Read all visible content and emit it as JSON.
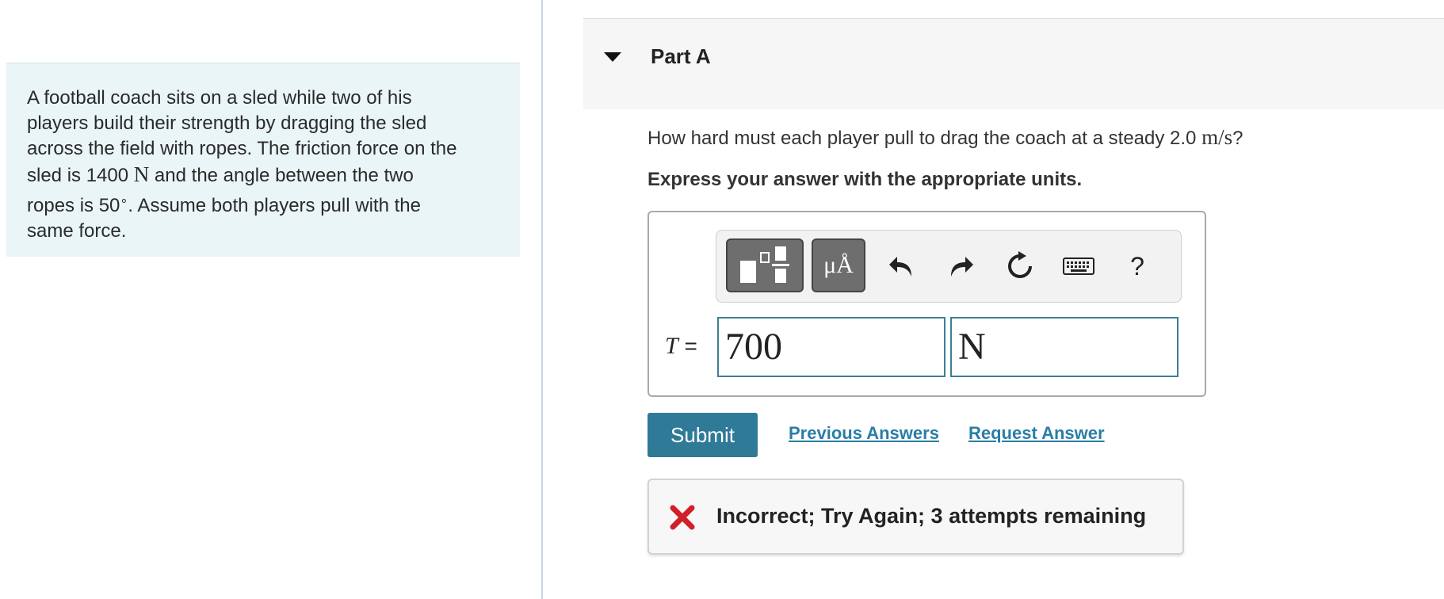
{
  "problem": {
    "line1": "A football coach sits on a sled while two of his",
    "line2": "players build their strength by dragging the sled",
    "line3": "across the field with ropes. The friction force on the",
    "line4_pre": "sled is 1400 ",
    "line4_unit": "N",
    "line4_post": " and the angle between the two",
    "line5_pre": "ropes is 50",
    "line5_deg": "∘",
    "line5_post": ". Assume both players pull with the",
    "line6": "same force."
  },
  "part": {
    "title": "Part A"
  },
  "question": {
    "text": "How hard must each player pull to drag the coach at a steady 2.0 ",
    "unit": "m/s",
    "end": "?"
  },
  "instruction": "Express your answer with the appropriate units.",
  "toolbar": {
    "units_button": "μÅ",
    "help": "?",
    "icons": [
      "templates-icon",
      "units-icon",
      "undo-icon",
      "redo-icon",
      "reset-icon",
      "keyboard-icon",
      "help-icon"
    ]
  },
  "answer": {
    "variable": "T",
    "equals": "=",
    "value": "700",
    "unit": "N"
  },
  "actions": {
    "submit": "Submit",
    "previous_answers": "Previous Answers",
    "request_answer": "Request Answer"
  },
  "feedback": {
    "text": "Incorrect; Try Again; 3 attempts remaining"
  },
  "colors": {
    "accent": "#2f7a97",
    "link": "#2a7da6",
    "error": "#d0202a",
    "problem_bg": "#eaf5f7"
  }
}
